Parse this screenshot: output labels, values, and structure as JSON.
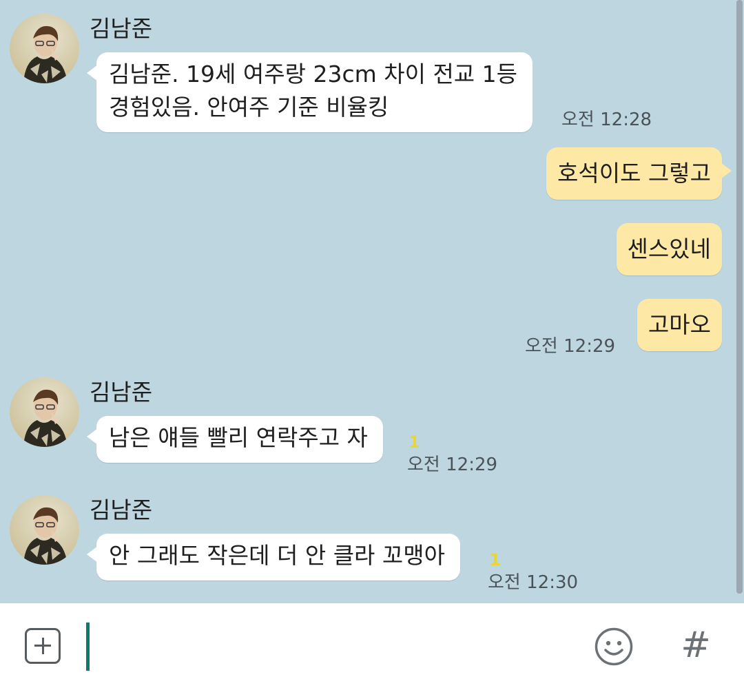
{
  "messages": [
    {
      "sender": "김남준",
      "lines": [
        "김남준. 19세 여주랑 23cm 차이 전교 1등",
        "경험있음. 안여주 기준 비율킹"
      ],
      "time": "오전 12:28"
    },
    {
      "text": "호석이도 그렇고"
    },
    {
      "text": "센스있네"
    },
    {
      "text": "고마오",
      "time": "오전 12:29"
    },
    {
      "sender": "김남준",
      "text": "남은 얘들 빨리 연락주고 자",
      "unread": "1",
      "time": "오전 12:29"
    },
    {
      "sender": "김남준",
      "text": "안 그래도 작은데 더 안 클라 꼬맹아",
      "unread": "1",
      "time": "오전 12:30"
    }
  ],
  "input": {
    "value": "",
    "placeholder": ""
  },
  "icons": {
    "attach": "plus-square-icon",
    "emoji": "smiley-icon",
    "hashtag": "hash-icon"
  },
  "colors": {
    "background": "#bed6e0",
    "incoming_bubble": "#ffffff",
    "outgoing_bubble": "#fde8a6",
    "unread": "#e6d63a",
    "caret": "#0f7a6b"
  }
}
